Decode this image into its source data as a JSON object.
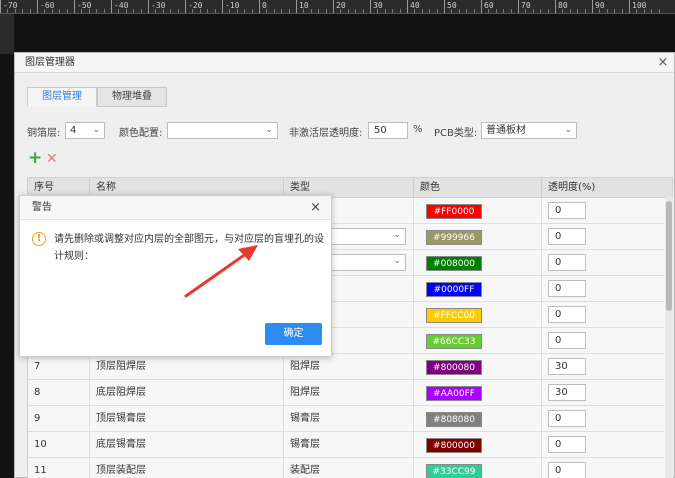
{
  "dialog": {
    "title": "图层管理器",
    "close": "×"
  },
  "tabs": [
    {
      "label": "图层管理"
    },
    {
      "label": "物理堆叠"
    }
  ],
  "toolbar": {
    "copper_label": "铜箔层:",
    "copper_value": "4",
    "color_label": "颜色配置:",
    "color_value": "",
    "inactive_label": "非激活层透明度:",
    "inactive_value": "50",
    "percent": "%",
    "pcb_label": "PCB类型:",
    "pcb_value": "普通板材"
  },
  "icons": {
    "add": "add-icon",
    "delete": "delete-icon"
  },
  "table": {
    "headers": [
      "序号",
      "名称",
      "类型",
      "颜色",
      "透明度(%)"
    ],
    "rows": [
      {
        "no": "",
        "name": "",
        "type": "",
        "color": "#FF0000",
        "opacity": "0"
      },
      {
        "no": "",
        "name": "",
        "type": "",
        "color": "#999966",
        "opacity": "0"
      },
      {
        "no": "",
        "name": "",
        "type": "",
        "color": "#008000",
        "opacity": "0"
      },
      {
        "no": "",
        "name": "",
        "type": "",
        "color": "#0000FF",
        "opacity": "0"
      },
      {
        "no": "",
        "name": "",
        "type": "",
        "color": "#FFCC00",
        "opacity": "0"
      },
      {
        "no": "",
        "name": "",
        "type": "",
        "color": "#66CC33",
        "opacity": "0"
      },
      {
        "no": "7",
        "name": "顶层阻焊层",
        "type": "阻焊层",
        "color": "#800080",
        "opacity": "30"
      },
      {
        "no": "8",
        "name": "底层阻焊层",
        "type": "阻焊层",
        "color": "#AA00FF",
        "opacity": "30"
      },
      {
        "no": "9",
        "name": "顶层锡膏层",
        "type": "锡膏层",
        "color": "#808080",
        "opacity": "0"
      },
      {
        "no": "10",
        "name": "底层锡膏层",
        "type": "锡膏层",
        "color": "#800000",
        "opacity": "0"
      },
      {
        "no": "11",
        "name": "顶层装配层",
        "type": "装配层",
        "color": "#33CC99",
        "opacity": "0"
      }
    ]
  },
  "alert": {
    "title": "警告",
    "close": "×",
    "icon": "!",
    "message": "请先删除或调整对应内层的全部图元，与对应层的盲埋孔的设计规则：",
    "ok": "确定"
  },
  "ruler": {
    "labels": [
      "-70",
      "-60",
      "-50",
      "-40",
      "-30",
      "-20",
      "-10",
      "0",
      "10",
      "20",
      "30",
      "40",
      "50",
      "60",
      "70",
      "80",
      "90",
      "100"
    ]
  },
  "colors": {
    "accent": "#2d8cf0",
    "warning": "#f0a020",
    "arrow": "#e8382f"
  }
}
